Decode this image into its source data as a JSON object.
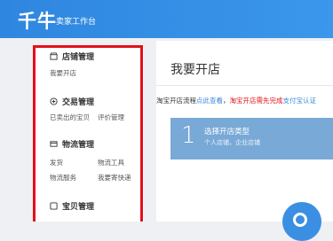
{
  "header": {
    "logo": "千牛",
    "subtitle": "卖家工作台"
  },
  "sidebar": {
    "sections": [
      {
        "title": "店铺管理",
        "icon": "shop-icon",
        "items": [
          "我要开店"
        ]
      },
      {
        "title": "交易管理",
        "icon": "trade-icon",
        "items": [
          "已卖出的宝贝",
          "评价管理"
        ]
      },
      {
        "title": "物流管理",
        "icon": "logistics-icon",
        "items": [
          "发货",
          "物流工具",
          "物流服务",
          "我要寄快递"
        ]
      },
      {
        "title": "宝贝管理",
        "icon": "goods-icon",
        "items": []
      }
    ]
  },
  "main": {
    "title": "我要开店",
    "notice": {
      "prefix": "淘宝开店流程",
      "link": "点此查看",
      "separator": "，",
      "warning": "淘宝开店需先完成",
      "link2": "支付宝认证"
    },
    "step": {
      "number": "1",
      "title": "选择开店类型",
      "desc": "个人店铺，企业店铺"
    }
  },
  "colors": {
    "header_bg": "#3a92e6",
    "highlight_border": "#e3101a",
    "step_bg": "#79a9d6"
  }
}
